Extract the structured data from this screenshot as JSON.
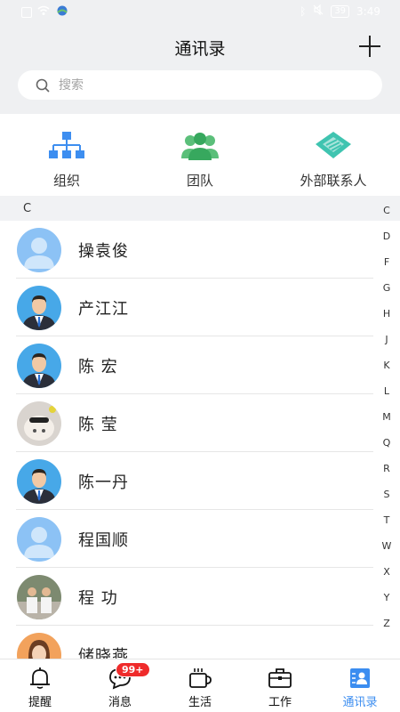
{
  "status_bar": {
    "battery": "39",
    "time": "3:49"
  },
  "header": {
    "title": "通讯录"
  },
  "search": {
    "placeholder": "搜索"
  },
  "quick_links": [
    {
      "label": "组织",
      "icon": "org-chart-icon"
    },
    {
      "label": "团队",
      "icon": "team-icon"
    },
    {
      "label": "外部联系人",
      "icon": "external-contact-icon"
    }
  ],
  "section_letter": "C",
  "contacts": [
    {
      "name": "操袁俊",
      "avatar": "default-avatar"
    },
    {
      "name": "产江江",
      "avatar": "suit-avatar"
    },
    {
      "name": "陈  宏",
      "avatar": "suit-avatar"
    },
    {
      "name": "陈  莹",
      "avatar": "photo-avatar"
    },
    {
      "name": "陈一丹",
      "avatar": "suit-avatar"
    },
    {
      "name": "程国顺",
      "avatar": "default-avatar"
    },
    {
      "name": "程  功",
      "avatar": "photo-avatar"
    },
    {
      "name": "储晓燕",
      "avatar": "female-avatar"
    }
  ],
  "index_letters": [
    "C",
    "D",
    "F",
    "G",
    "H",
    "J",
    "K",
    "L",
    "M",
    "Q",
    "R",
    "S",
    "T",
    "W",
    "X",
    "Y",
    "Z"
  ],
  "tabs": [
    {
      "label": "提醒",
      "icon": "bell-icon"
    },
    {
      "label": "消息",
      "icon": "chat-icon",
      "badge": "99+"
    },
    {
      "label": "生活",
      "icon": "cup-icon"
    },
    {
      "label": "工作",
      "icon": "briefcase-icon"
    },
    {
      "label": "通讯录",
      "icon": "contacts-icon",
      "active": true
    }
  ],
  "colors": {
    "accent": "#3b8df0",
    "badge": "#ef2b2b",
    "header_bg": "#eff0f2"
  }
}
